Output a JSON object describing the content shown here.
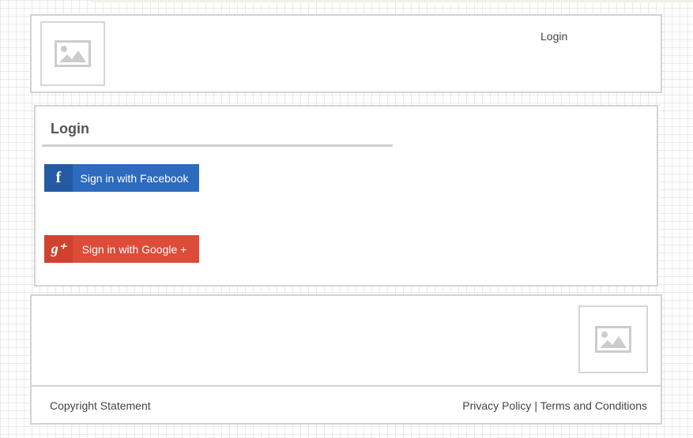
{
  "header": {
    "logo_icon": "image-placeholder-icon",
    "login_link": "Login"
  },
  "main": {
    "title": "Login",
    "facebook_button": {
      "icon": "facebook-icon",
      "icon_glyph": "f",
      "label": "Sign in with Facebook",
      "color": "#2d6bbf"
    },
    "google_button": {
      "icon": "google-plus-icon",
      "icon_glyph": "g⁺",
      "label": "Sign in with Google +",
      "color": "#dd4b39"
    }
  },
  "footer": {
    "image_icon": "image-placeholder-icon",
    "copyright": "Copyright Statement",
    "privacy_link": "Privacy Policy",
    "separator": "|",
    "terms_link": "Terms and Conditions"
  }
}
